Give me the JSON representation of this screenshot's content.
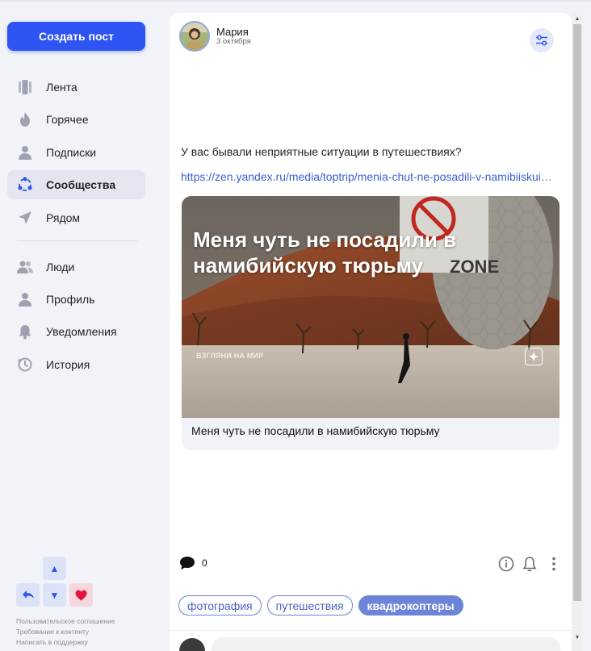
{
  "sidebar": {
    "create_post_label": "Создать пост",
    "nav_primary": [
      {
        "label": "Лента",
        "icon": "feed-icon"
      },
      {
        "label": "Горячее",
        "icon": "flame-icon"
      },
      {
        "label": "Подписки",
        "icon": "person-icon"
      },
      {
        "label": "Сообщества",
        "icon": "communities-icon",
        "active": true
      },
      {
        "label": "Рядом",
        "icon": "location-arrow-icon"
      }
    ],
    "nav_secondary": [
      {
        "label": "Люди",
        "icon": "people-icon"
      },
      {
        "label": "Профиль",
        "icon": "person-icon"
      },
      {
        "label": "Уведомления",
        "icon": "bell-icon"
      },
      {
        "label": "История",
        "icon": "history-icon"
      }
    ],
    "arrow_controls": {
      "up": "▲",
      "down": "▼",
      "back": "back-arrow-icon",
      "like": "heart-icon"
    },
    "footer_links": [
      "Пользовательское соглашение",
      "Требование к контенту",
      "Написать в поддержку"
    ]
  },
  "post": {
    "author": "Мария",
    "date": "3 октября",
    "text": "У вас бывали неприятные ситуации в путешествиях?",
    "link": "https://zen.yandex.ru/media/toptrip/menia-chut-ne-posadili-v-namibiiskuiu-turmu",
    "preview": {
      "overlay_title": "Меня чуть не посадили в намибийскую тюрьму",
      "channel_label": "ВЗГЛЯНИ НА МИР",
      "sign_text": "ZONE",
      "caption": "Меня чуть не посадили в намибийскую тюрьму"
    },
    "comment_count": "0",
    "tags": [
      {
        "label": "фотография",
        "filled": false
      },
      {
        "label": "путешествия",
        "filled": false
      },
      {
        "label": "квадрокоптеры",
        "filled": true
      }
    ]
  },
  "colors": {
    "accent": "#2f54f4",
    "link": "#3a5fd6",
    "tag_border": "#6a82d8",
    "tag_filled": "#6c85d9",
    "heart": "#e3143b"
  }
}
